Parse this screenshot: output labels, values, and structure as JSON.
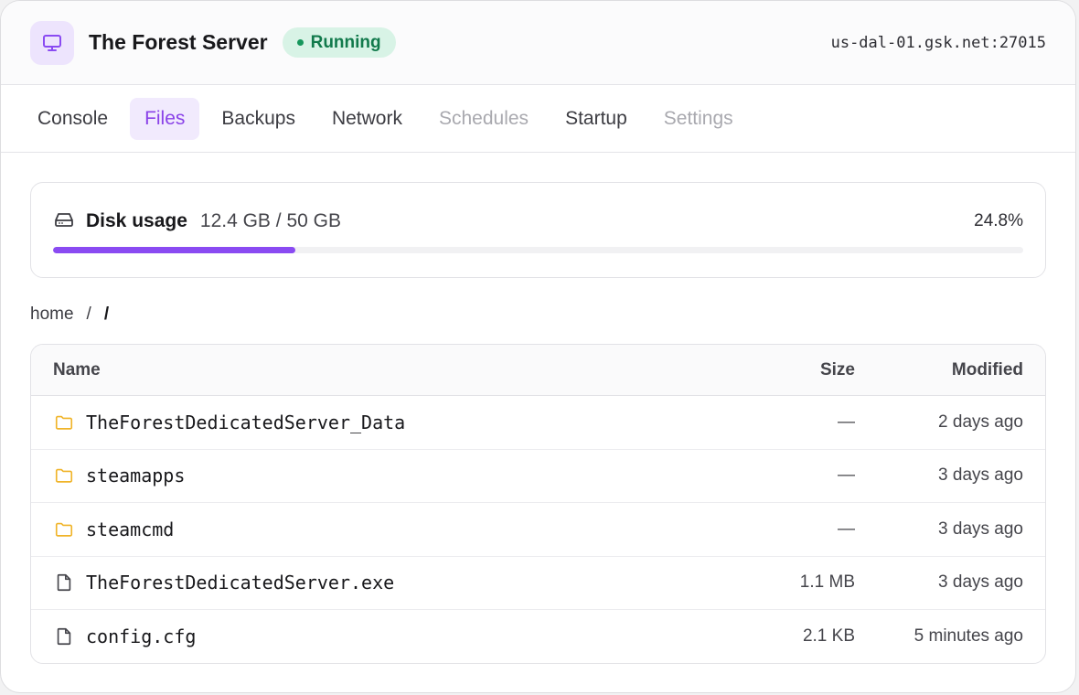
{
  "header": {
    "server_name": "The Forest Server",
    "status": "Running",
    "address": "us-dal-01.gsk.net:27015",
    "icon": "monitor-icon"
  },
  "tabs": [
    {
      "label": "Console",
      "state": "normal"
    },
    {
      "label": "Files",
      "state": "active"
    },
    {
      "label": "Backups",
      "state": "normal"
    },
    {
      "label": "Network",
      "state": "normal"
    },
    {
      "label": "Schedules",
      "state": "disabled"
    },
    {
      "label": "Startup",
      "state": "normal"
    },
    {
      "label": "Settings",
      "state": "disabled"
    }
  ],
  "disk": {
    "label": "Disk usage",
    "value": "12.4 GB / 50 GB",
    "percent": "24.8%",
    "fill_fraction": 0.25,
    "icon": "hard-drive-icon"
  },
  "breadcrumb": {
    "root": "home",
    "separator": "/",
    "current": "/"
  },
  "table": {
    "headers": {
      "name": "Name",
      "size": "Size",
      "modified": "Modified"
    },
    "rows": [
      {
        "type": "folder",
        "name": "TheForestDedicatedServer_Data",
        "size": "—",
        "modified": "2 days ago"
      },
      {
        "type": "folder",
        "name": "steamapps",
        "size": "—",
        "modified": "3 days ago"
      },
      {
        "type": "folder",
        "name": "steamcmd",
        "size": "—",
        "modified": "3 days ago"
      },
      {
        "type": "file",
        "name": "TheForestDedicatedServer.exe",
        "size": "1.1 MB",
        "modified": "3 days ago"
      },
      {
        "type": "file",
        "name": "config.cfg",
        "size": "2.1 KB",
        "modified": "5 minutes ago"
      }
    ]
  },
  "colors": {
    "accent": "#8a4bf2",
    "status_bg": "#d8f3e6",
    "status_text": "#127a4c",
    "folder": "#f0b429"
  }
}
